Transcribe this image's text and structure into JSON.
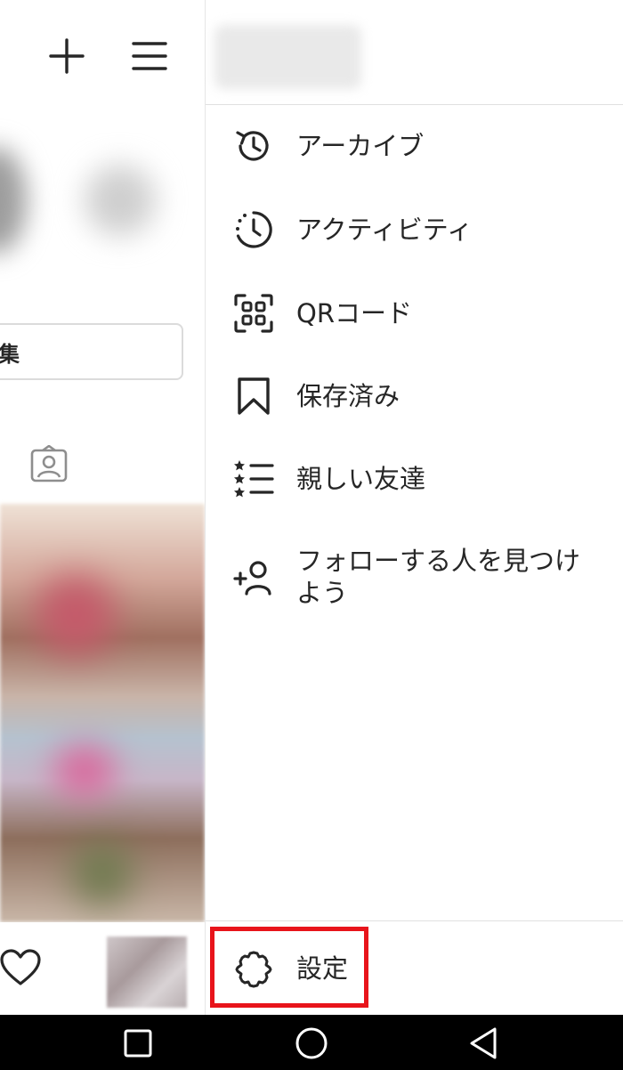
{
  "background_profile": {
    "top_icons": [
      "plus-icon",
      "hamburger-menu-icon"
    ],
    "edit_button_label": "集",
    "tagged_tab_icon": "tagged-person-icon",
    "bottom_nav_icons": [
      "heart-icon"
    ]
  },
  "drawer": {
    "menu_items": [
      {
        "label": "アーカイブ",
        "icon": "archive-history-icon"
      },
      {
        "label": "アクティビティ",
        "icon": "activity-clock-icon"
      },
      {
        "label": "QRコード",
        "icon": "qr-code-icon"
      },
      {
        "label": "保存済み",
        "icon": "bookmark-icon"
      },
      {
        "label": "親しい友達",
        "icon": "close-friends-list-icon"
      },
      {
        "label": "フォローする人を見つけよう",
        "icon": "add-person-icon"
      }
    ],
    "settings": {
      "label": "設定",
      "icon": "gear-icon",
      "highlight_color": "#e8141b"
    }
  },
  "system_nav": {
    "buttons": [
      "recent-apps-icon",
      "home-icon",
      "back-icon"
    ]
  },
  "colors": {
    "text": "#262626",
    "divider": "#e0e0e0",
    "highlight": "#e8141b",
    "nav_bar": "#000000"
  }
}
